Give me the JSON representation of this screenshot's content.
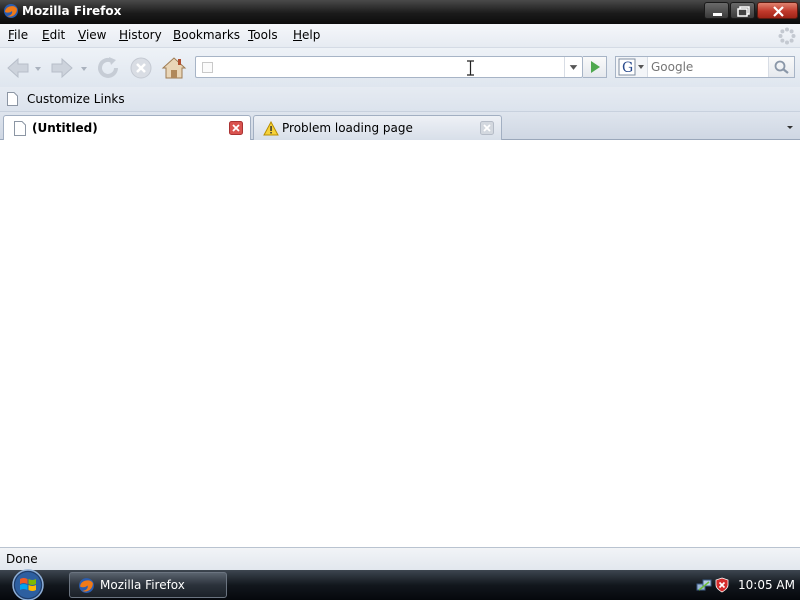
{
  "window": {
    "title": "Mozilla Firefox"
  },
  "menu": {
    "items": [
      "File",
      "Edit",
      "View",
      "History",
      "Bookmarks",
      "Tools",
      "Help"
    ]
  },
  "navigation": {
    "url_value": "",
    "search_placeholder": "Google",
    "search_engine_icon": "google-g-icon"
  },
  "bookmarks_toolbar": {
    "items": [
      {
        "label": "Customize Links",
        "icon": "page-icon"
      }
    ]
  },
  "tabs": [
    {
      "label": "(Untitled)",
      "icon": "page-icon",
      "active": true
    },
    {
      "label": "Problem loading page",
      "icon": "warning-icon",
      "active": false
    }
  ],
  "statusbar": {
    "status": "Done"
  },
  "taskbar": {
    "items": [
      {
        "label": "Mozilla Firefox",
        "icon": "firefox-icon"
      }
    ],
    "clock": "10:05 AM"
  },
  "colors": {
    "title_bar": "#1b1b1b",
    "close_button": "#c0392b",
    "toolbar": "#e6ebf2",
    "taskbar": "#12171d"
  }
}
